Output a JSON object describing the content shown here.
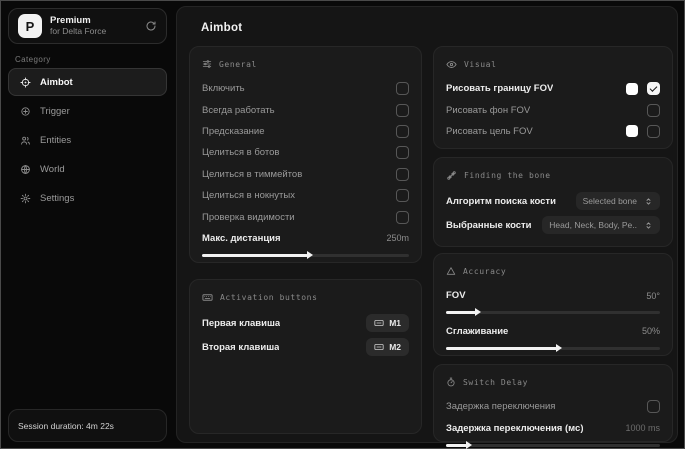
{
  "brand": {
    "logo_letter": "P",
    "name": "Premium",
    "subtitle": "for Delta Force"
  },
  "sidebar": {
    "category_label": "Category",
    "items": [
      {
        "label": "Aimbot"
      },
      {
        "label": "Trigger"
      },
      {
        "label": "Entities"
      },
      {
        "label": "World"
      },
      {
        "label": "Settings"
      }
    ],
    "session_duration": "Session duration: 4m 22s"
  },
  "page": {
    "title": "Aimbot"
  },
  "general": {
    "header": "General",
    "rows": [
      {
        "label": "Включить",
        "checked": false
      },
      {
        "label": "Всегда работать",
        "checked": false
      },
      {
        "label": "Предсказание",
        "checked": false
      },
      {
        "label": "Целиться в ботов",
        "checked": false
      },
      {
        "label": "Целиться в тиммейтов",
        "checked": false
      },
      {
        "label": "Целиться в нокнутых",
        "checked": false
      },
      {
        "label": "Проверка видимости",
        "checked": false
      }
    ],
    "distance": {
      "label": "Макс. дистанция",
      "value": "250m",
      "fill": "51%"
    }
  },
  "activation": {
    "header": "Activation buttons",
    "rows": [
      {
        "label": "Первая клавиша",
        "key": "M1"
      },
      {
        "label": "Вторая клавиша",
        "key": "M2"
      }
    ]
  },
  "visual": {
    "header": "Visual",
    "swatch_color": "#ffffff",
    "rows": [
      {
        "label": "Рисовать границу FOV",
        "has_swatch": true,
        "checked": true
      },
      {
        "label": "Рисовать фон FOV",
        "has_swatch": false,
        "checked": false
      },
      {
        "label": "Рисовать цель FOV",
        "has_swatch": true,
        "checked": false
      }
    ]
  },
  "bone": {
    "header": "Finding the bone",
    "rows": [
      {
        "label": "Алгоритм поиска кости",
        "value": "Selected bone"
      },
      {
        "label": "Выбранные кости",
        "value": "Head, Neck, Body, Pe.."
      }
    ]
  },
  "accuracy": {
    "header": "Accuracy",
    "sliders": [
      {
        "label": "FOV",
        "value": "50°",
        "fill": "14%"
      },
      {
        "label": "Сглаживание",
        "value": "50%",
        "fill": "52%"
      }
    ]
  },
  "switch_delay": {
    "header": "Switch Delay",
    "toggle": {
      "label": "Задержка переключения",
      "checked": false
    },
    "slider": {
      "label": "Задержка переключения (мс)",
      "value": "1000 ms",
      "fill": "10%"
    }
  }
}
